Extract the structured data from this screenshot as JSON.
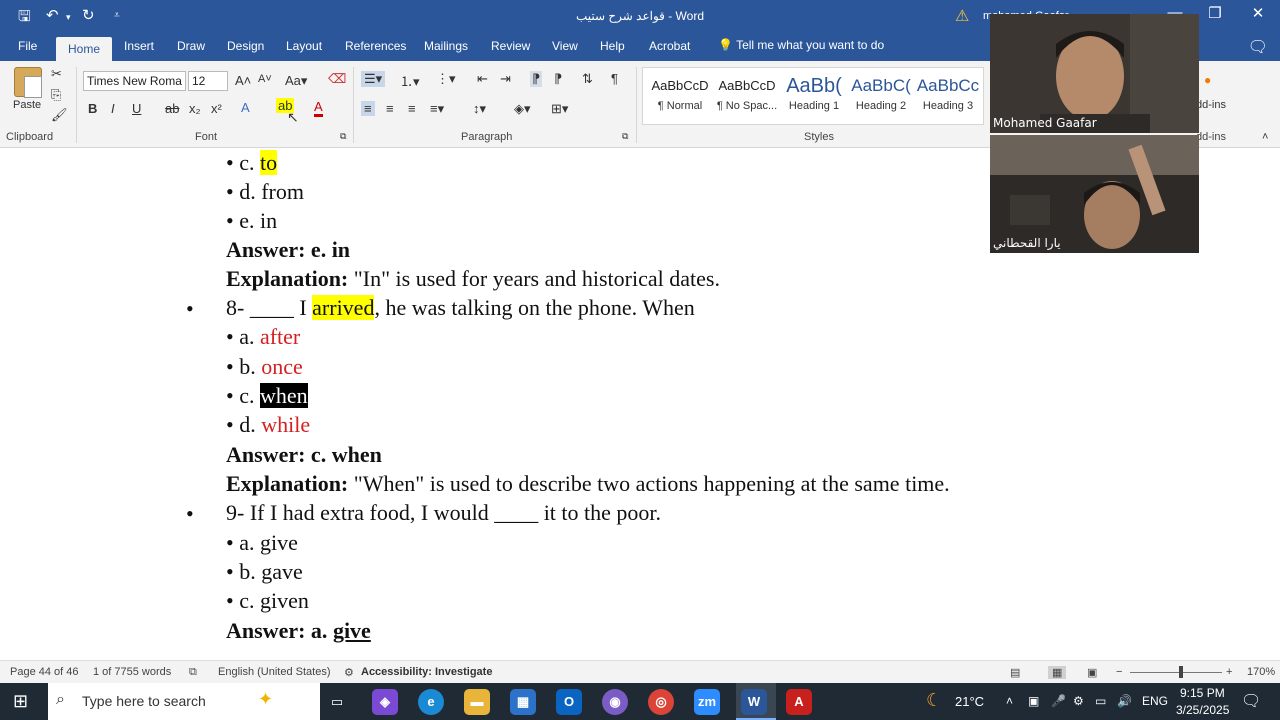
{
  "titlebar": {
    "title": "قواعد شرح ستيب - Word",
    "user": "mohamed Gaafar"
  },
  "menu": {
    "file": "File",
    "home": "Home",
    "insert": "Insert",
    "draw": "Draw",
    "design": "Design",
    "layout": "Layout",
    "references": "References",
    "mailings": "Mailings",
    "review": "Review",
    "view": "View",
    "help": "Help",
    "acrobat": "Acrobat",
    "tell_me": "Tell me what you want to do"
  },
  "ribbon": {
    "paste": "Paste",
    "clipboard": "Clipboard",
    "font_name": "Times New Roma",
    "font_size": "12",
    "font_group": "Font",
    "paragraph_group": "Paragraph",
    "styles_group": "Styles",
    "addins_label": "dd-ins",
    "addins_group": "dd-ins",
    "styles": [
      {
        "sample": "AaBbCcD",
        "name": "¶ Normal"
      },
      {
        "sample": "AaBbCcD",
        "name": "¶ No Spac..."
      },
      {
        "sample": "AaBb(",
        "name": "Heading 1"
      },
      {
        "sample": "AaBbC(",
        "name": "Heading 2"
      },
      {
        "sample": "AaBbCc",
        "name": "Heading 3"
      }
    ]
  },
  "video": {
    "person1": "Mohamed Gaafar",
    "person2": "يارا القحطاني"
  },
  "document": {
    "l1_prefix": "• c. ",
    "l1_word": "to",
    "l2": "• d. from",
    "l3": "• e. in",
    "l4": "Answer: e. in",
    "l5_label": "Explanation:",
    "l5_text": " \"In\" is used for years and historical dates.",
    "l6_pre": "8- ____ I ",
    "l6_word": "arrived",
    "l6_post": ", he was talking on the phone. When",
    "l7_prefix": "• a. ",
    "l7_word": "after",
    "l8_prefix": "• b. ",
    "l8_word": "once",
    "l9_prefix": "• c. ",
    "l9_word": "when",
    "l10_prefix": "• d. ",
    "l10_word": "while",
    "l11": "Answer: c. when",
    "l12_label": "Explanation:",
    "l12_text": " \"When\" is used to describe two actions happening at the same time.",
    "l13": "9- If I had extra food, I would ____ it to the poor.",
    "l14": "• a. give",
    "l15": "• b. gave",
    "l16": "• c. given",
    "l17_pre": "Answer: a. ",
    "l17_word": "give"
  },
  "status": {
    "page": "Page 44 of 46",
    "words": "1 of 7755 words",
    "language": "English (United States)",
    "accessibility": "Accessibility: Investigate",
    "zoom": "170%"
  },
  "taskbar": {
    "search_placeholder": "Type here to search",
    "weather": "21°C",
    "lang": "ENG",
    "time": "9:15 PM",
    "date": "3/25/2025"
  }
}
